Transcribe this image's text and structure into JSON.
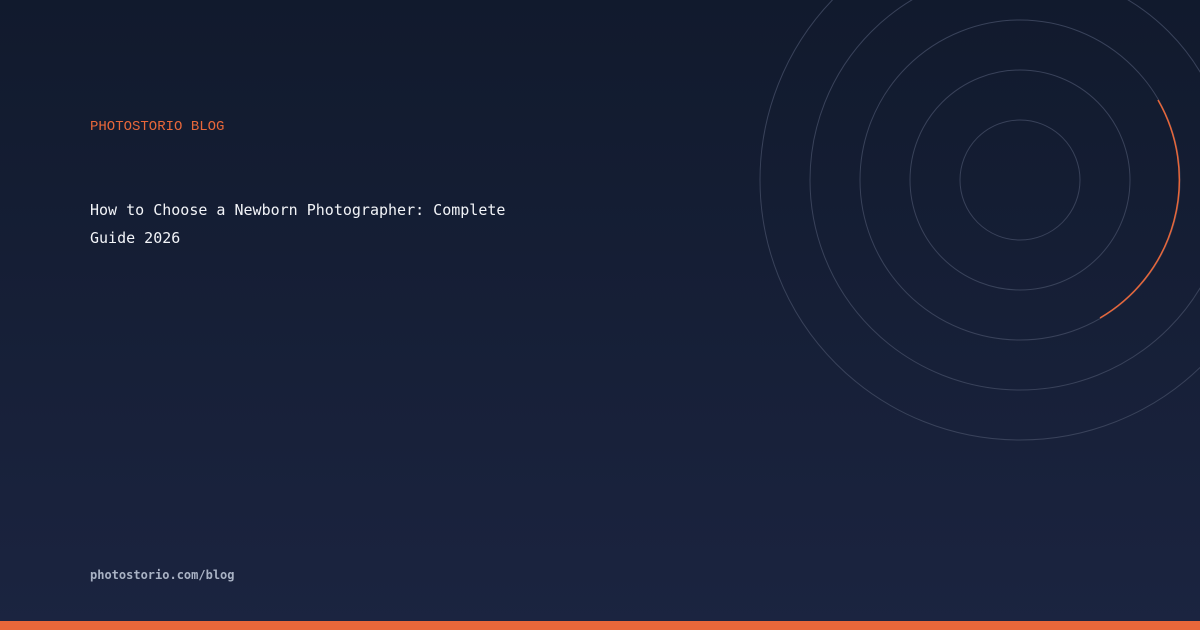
{
  "brand": {
    "eyebrow": "PHOTOSTORIO BLOG",
    "url": "photostorio.com/blog"
  },
  "post": {
    "title": "How to Choose a Newborn Photographer: Complete Guide 2026"
  },
  "colors": {
    "accent": "#e8673a",
    "background_top": "#111a2d",
    "background_bottom": "#1b2440",
    "ring": "#39425a",
    "title_text": "#f2f4f8",
    "url_text": "#a9b2c4"
  },
  "decor": {
    "ring_count": 5,
    "accent_arc_icon": "orange-arc"
  }
}
